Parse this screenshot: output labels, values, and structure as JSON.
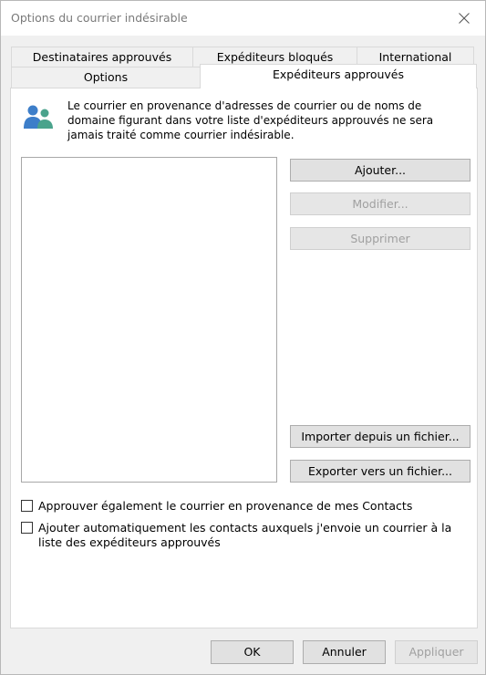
{
  "window": {
    "title": "Options du courrier indésirable",
    "close_icon": "close-icon"
  },
  "tabs_back_row": [
    {
      "label": "Destinataires approuvés"
    },
    {
      "label": "Expéditeurs bloqués"
    },
    {
      "label": "International"
    }
  ],
  "tabs_front_row": [
    {
      "label": "Options"
    },
    {
      "label": "Expéditeurs approuvés",
      "active": true
    }
  ],
  "panel": {
    "info_icon": "people-icon",
    "info_text": "Le courrier en provenance d'adresses de courrier ou de noms de domaine figurant dans votre liste d'expéditeurs approuvés ne sera jamais traité comme courrier indésirable.",
    "list_items": [],
    "buttons": {
      "add": "Ajouter...",
      "edit": "Modifier...",
      "remove": "Supprimer",
      "import": "Importer depuis un fichier...",
      "export": "Exporter vers un fichier..."
    },
    "checkboxes": [
      {
        "label": "Approuver également le courrier en provenance de mes Contacts",
        "checked": false
      },
      {
        "label": "Ajouter automatiquement les contacts auxquels j'envoie un courrier à la liste des expéditeurs approuvés",
        "checked": false
      }
    ]
  },
  "footer": {
    "ok": "OK",
    "cancel": "Annuler",
    "apply": "Appliquer"
  },
  "colors": {
    "dialog_bg": "#f0f0f0",
    "button_bg": "#e1e1e1",
    "disabled_text": "#a0a0a0",
    "icon_blue": "#3d7ec9",
    "icon_teal": "#4aa38c"
  }
}
